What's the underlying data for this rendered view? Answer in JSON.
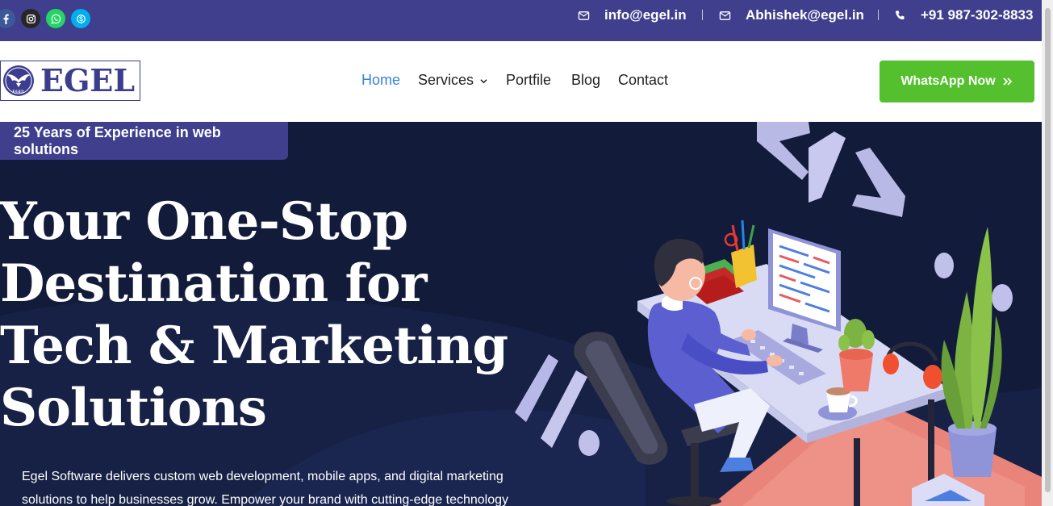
{
  "topbar": {
    "social": [
      {
        "name": "facebook-icon",
        "color": "#3b5998"
      },
      {
        "name": "instagram-icon",
        "color": "#262626"
      },
      {
        "name": "whatsapp-icon",
        "color": "#25d366"
      },
      {
        "name": "skype-icon",
        "color": "#00aff0"
      }
    ],
    "email1": "info@egel.in",
    "email2": "Abhishek@egel.in",
    "phone": "+91 987-302-8833"
  },
  "nav": {
    "logo_text": "EGEL",
    "logo_badge": "EGEL",
    "items": [
      {
        "label": "Home",
        "active": true
      },
      {
        "label": "Services",
        "has_caret": true
      },
      {
        "label": "Portfile"
      },
      {
        "label": "Blog"
      },
      {
        "label": "Contact"
      }
    ],
    "cta_label": "WhatsApp Now"
  },
  "hero": {
    "badge": "25 Years of Experience in web solutions",
    "headline_lines": [
      "Your One-Stop",
      "Destination for",
      "Tech & Marketing",
      "Solutions"
    ],
    "description_lines": [
      "Egel Software delivers custom web development, mobile apps, and digital marketing",
      "solutions to help businesses grow. Empower your brand with cutting-edge technology"
    ]
  },
  "colors": {
    "topbar_bg": "#3f3f8d",
    "hero_bg": "#121b3a",
    "accent_blue": "#3b82d6",
    "cta_green": "#54c02d"
  }
}
